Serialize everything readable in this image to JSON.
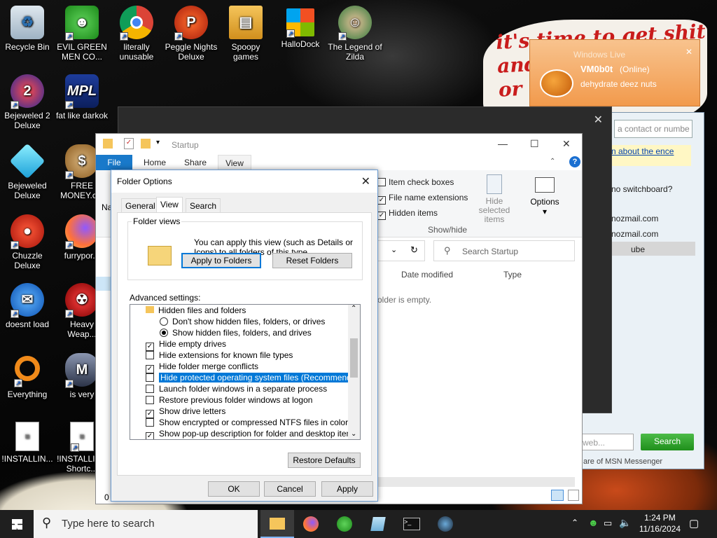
{
  "desktop": {
    "icons": [
      {
        "label": "Recycle Bin",
        "icon": "recycle-bin-icon"
      },
      {
        "label": "EVIL GREEN MEN CO...",
        "icon": "msn-people-icon"
      },
      {
        "label": "literally unusable",
        "icon": "chrome-icon"
      },
      {
        "label": "Peggle Nights Deluxe",
        "icon": "peggle-icon"
      },
      {
        "label": "Spoopy games",
        "icon": "folder-icon"
      },
      {
        "label": "HalloDock",
        "icon": "windows-flag-icon"
      },
      {
        "label": "The Legend of Zilda",
        "icon": "character-icon"
      },
      {
        "label": "Bejeweled 2 Deluxe",
        "icon": "bejeweled2-icon"
      },
      {
        "label": "fat like darkok",
        "icon": "mpl-icon"
      },
      {
        "label": "Bejeweled Deluxe",
        "icon": "diamond-icon"
      },
      {
        "label": "FREE MONEY.c...",
        "icon": "money-bag-icon"
      },
      {
        "label": "Chuzzle Deluxe",
        "icon": "chuzzle-icon"
      },
      {
        "label": "furrypor...",
        "icon": "firefox-icon"
      },
      {
        "label": "doesnt load",
        "icon": "thunderbird-icon"
      },
      {
        "label": "Heavy Weap...",
        "icon": "radiation-icon"
      },
      {
        "label": "Everything",
        "icon": "everything-search-icon"
      },
      {
        "label": "is very",
        "icon": "shield-icon"
      },
      {
        "label": "!INSTALLIN...",
        "icon": "text-file-icon"
      },
      {
        "label": "!INSTALLI... - Shortc...",
        "icon": "text-file-icon"
      }
    ],
    "meme_text": "it's time to get shit\nand\nor t"
  },
  "msn_popup": {
    "title": "Windows Live",
    "contact_name": "VM0b0t",
    "status": "(Online)",
    "message": "dehydrate deez nuts"
  },
  "msn_window": {
    "search_placeholder": "a contact or numbe",
    "learn_link": "n about the ence",
    "rows": [
      "no switchboard?",
      "nozmail.com",
      "nozmail.com",
      "ube"
    ],
    "web_placeholder": "web...",
    "search_button": "Search",
    "footer": "are of MSN Messenger"
  },
  "explorer": {
    "title": "Startup",
    "tabs": [
      "File",
      "Home",
      "Share",
      "View"
    ],
    "ribbon": {
      "item_check_boxes": "Item check boxes",
      "file_name_extensions": "File name extensions",
      "hidden_items": "Hidden items",
      "hide_selected": "Hide selected items",
      "options": "Options",
      "group_label": "Show/hide",
      "nav_partial": "Nav"
    },
    "search_placeholder": "Search Startup",
    "columns": [
      "Date modified",
      "Type"
    ],
    "empty_text": "older is empty.",
    "status_partial": "0"
  },
  "dialog": {
    "title": "Folder Options",
    "tabs": [
      "General",
      "View",
      "Search"
    ],
    "folder_views_legend": "Folder views",
    "folder_views_text": "You can apply this view (such as Details or Icons) to all folders of this type.",
    "apply_to_folders": "Apply to Folders",
    "reset_folders": "Reset Folders",
    "advanced_label": "Advanced settings:",
    "settings": [
      {
        "kind": "folder",
        "label": "Hidden files and folders"
      },
      {
        "kind": "radio",
        "checked": false,
        "label": "Don't show hidden files, folders, or drives"
      },
      {
        "kind": "radio",
        "checked": true,
        "label": "Show hidden files, folders, and drives"
      },
      {
        "kind": "check",
        "checked": true,
        "label": "Hide empty drives"
      },
      {
        "kind": "check",
        "checked": false,
        "label": "Hide extensions for known file types"
      },
      {
        "kind": "check",
        "checked": true,
        "label": "Hide folder merge conflicts"
      },
      {
        "kind": "check",
        "checked": false,
        "label": "Hide protected operating system files (Recommended)",
        "selected": true
      },
      {
        "kind": "check",
        "checked": false,
        "label": "Launch folder windows in a separate process"
      },
      {
        "kind": "check",
        "checked": false,
        "label": "Restore previous folder windows at logon"
      },
      {
        "kind": "check",
        "checked": true,
        "label": "Show drive letters"
      },
      {
        "kind": "check",
        "checked": false,
        "label": "Show encrypted or compressed NTFS files in color"
      },
      {
        "kind": "check",
        "checked": true,
        "label": "Show pop-up description for folder and desktop items"
      }
    ],
    "restore_defaults": "Restore Defaults",
    "ok": "OK",
    "cancel": "Cancel",
    "apply": "Apply"
  },
  "taskbar": {
    "search_placeholder": "Type here to search",
    "time": "1:24 PM",
    "date": "11/16/2024",
    "pinned": [
      "file-explorer-icon",
      "firefox-icon",
      "msn-messenger-icon",
      "notepad-icon",
      "terminal-icon",
      "steam-icon"
    ]
  }
}
